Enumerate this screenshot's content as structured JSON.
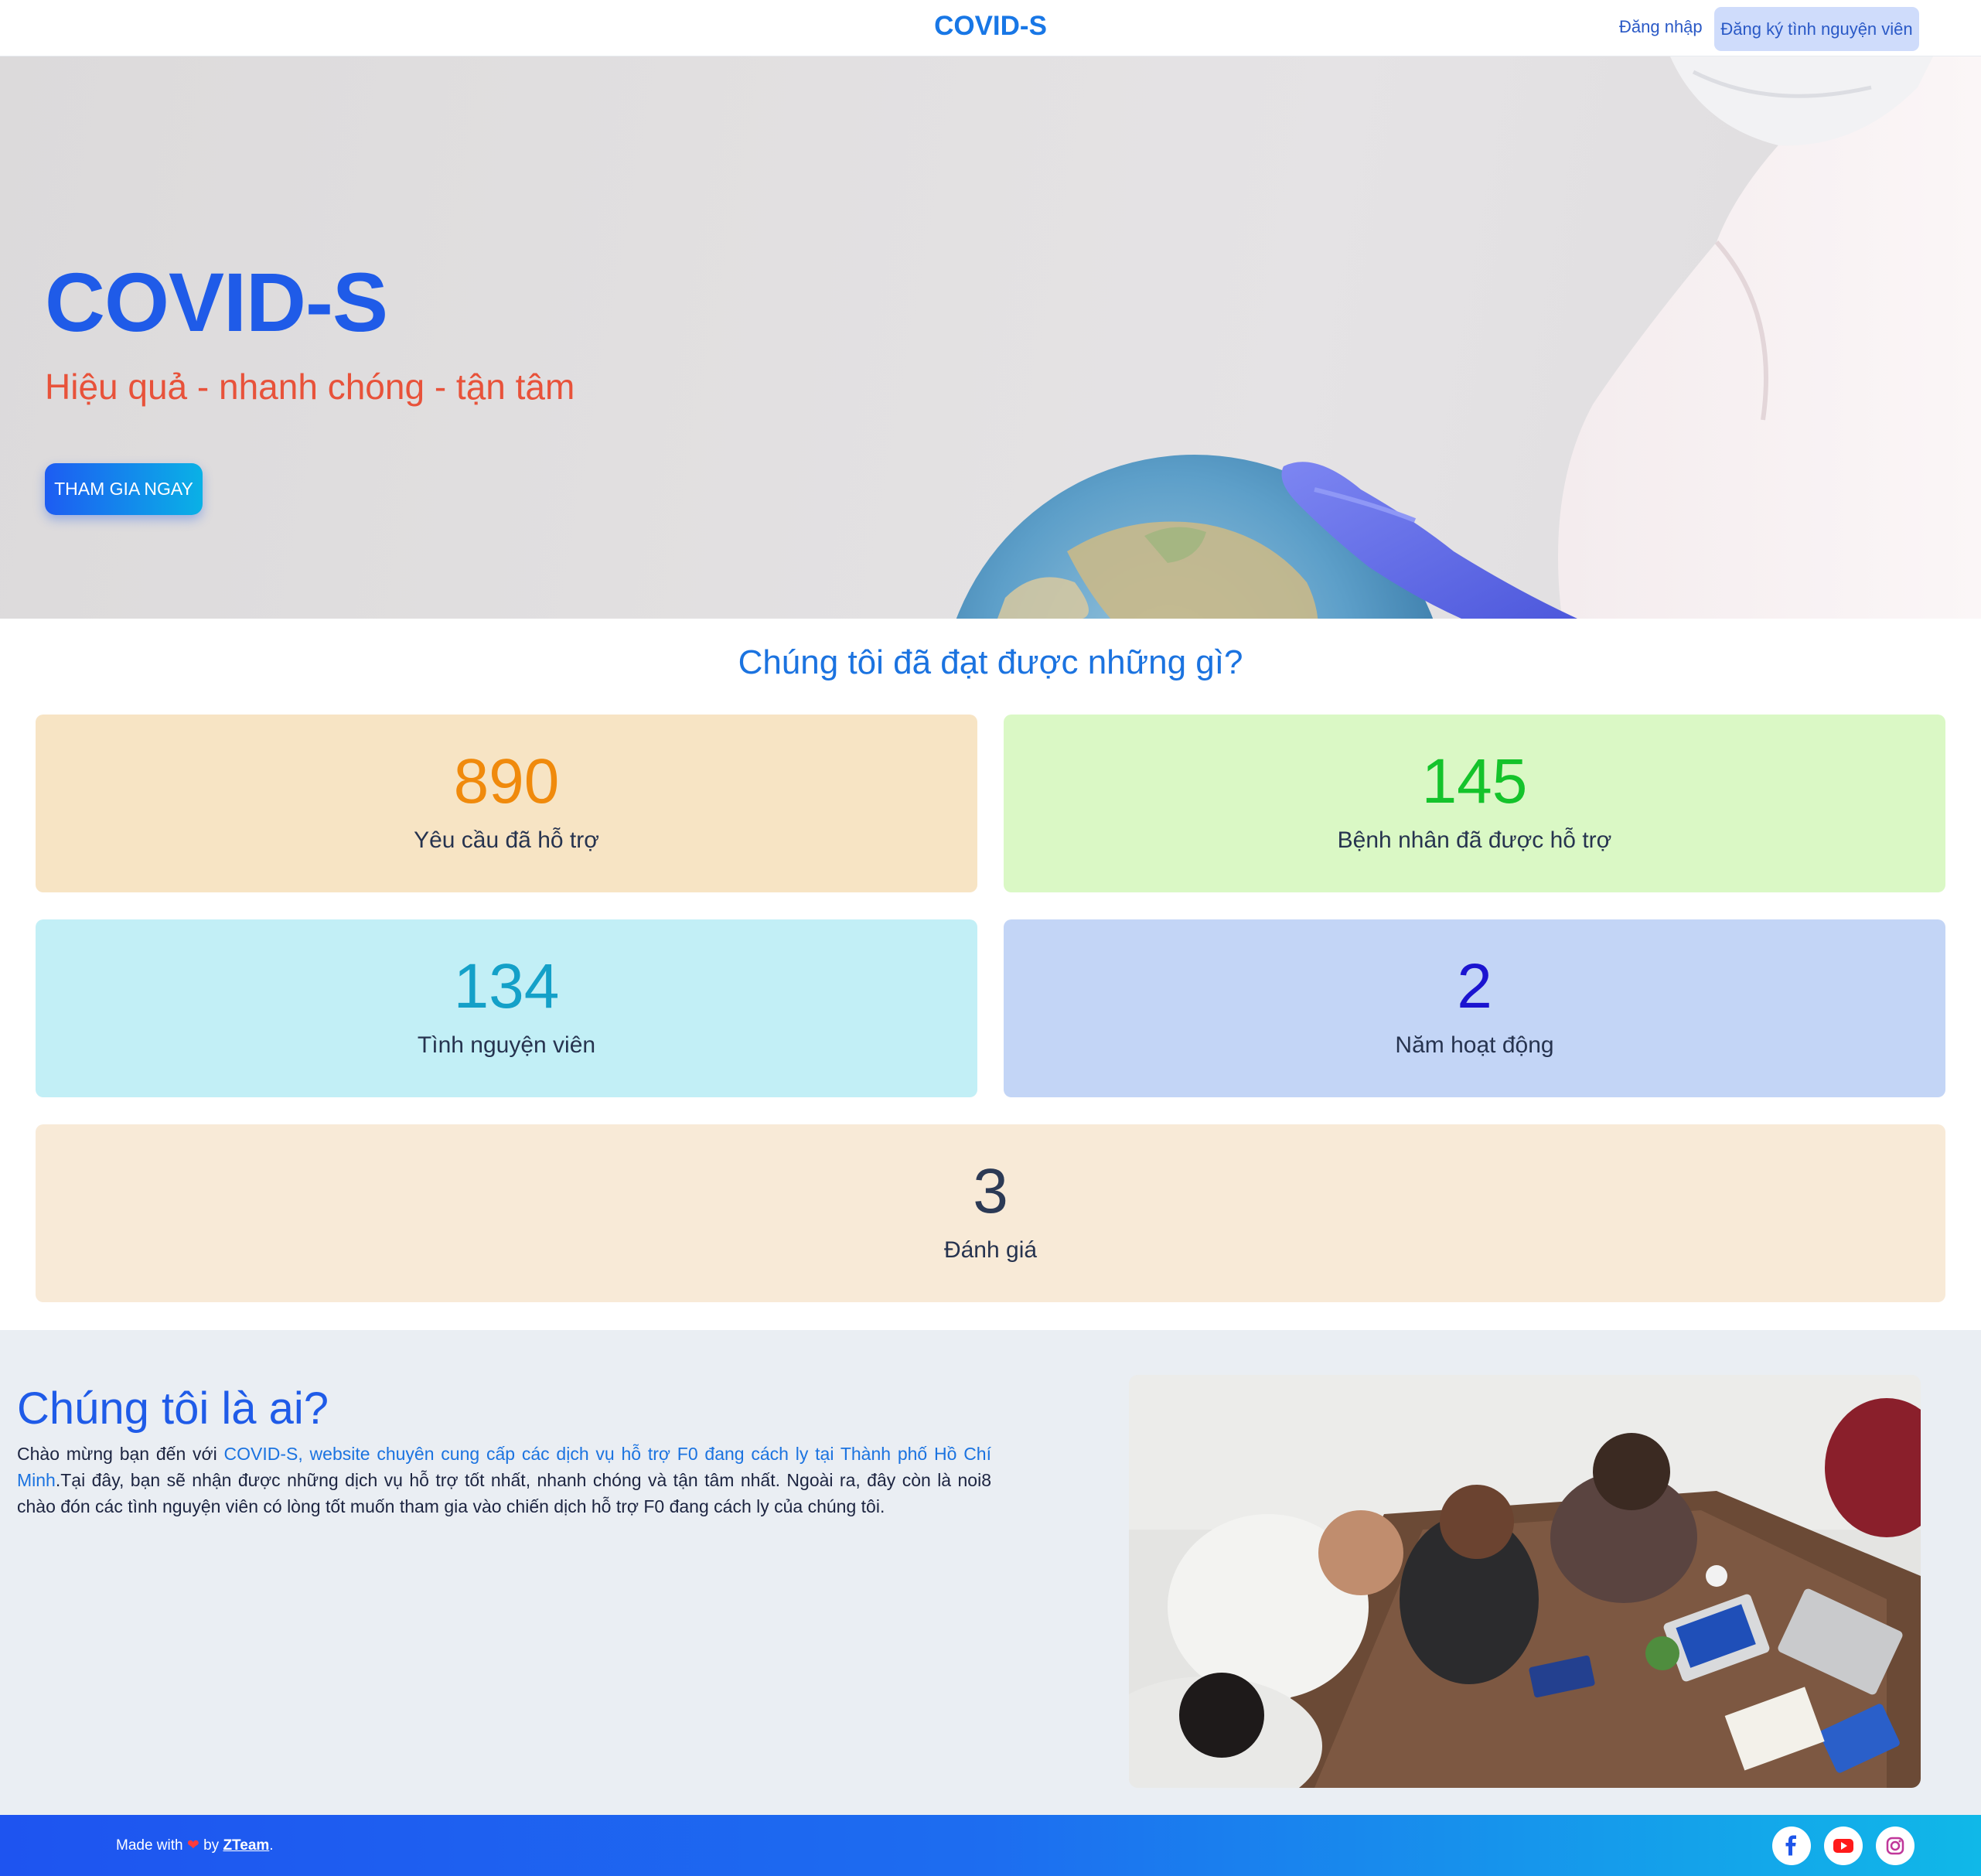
{
  "header": {
    "brand": "COVID-S",
    "login_label": "Đăng nhập",
    "register_label": "Đăng ký tình nguyện viên"
  },
  "hero": {
    "title": "COVID-S",
    "subtitle": "Hiệu quả - nhanh chóng - tận tâm",
    "cta_label": "THAM GIA NGAY"
  },
  "stats": {
    "title": "Chúng tôi đã đạt được những gì?",
    "items": [
      {
        "value": "890",
        "label": "Yêu cầu đã hỗ trợ",
        "color": "#f08a0c"
      },
      {
        "value": "145",
        "label": "Bệnh nhân đã được hỗ trợ",
        "color": "#14c32b"
      },
      {
        "value": "134",
        "label": "Tình nguyện viên",
        "color": "#14a0c8"
      },
      {
        "value": "2",
        "label": "Năm hoạt động",
        "color": "#1b14d0"
      },
      {
        "value": "3",
        "label": "Đánh giá",
        "color": "#2c3a55"
      }
    ]
  },
  "about": {
    "title": "Chúng tôi là ai?",
    "text_intro": "Chào mừng bạn đến với ",
    "text_highlight": "COVID-S, website chuyên cung cấp các dịch vụ hỗ trợ F0 đang cách ly tại Thành phố Hồ Chí Minh",
    "text_rest": ".Tại đây, bạn sẽ nhận được những dịch vụ hỗ trợ tốt nhất, nhanh chóng và tận tâm nhất. Ngoài ra, đây còn là noi8 chào đón các tình nguyện viên có lòng tốt muốn tham gia vào chiến dịch hỗ trợ F0 đang cách ly của chúng tôi."
  },
  "footer": {
    "made_with": "Made with",
    "by": "by",
    "team": "ZTeam",
    "period": ".",
    "social": [
      "facebook-icon",
      "youtube-icon",
      "instagram-icon"
    ]
  },
  "colors": {
    "brand_blue": "#1877e6",
    "accent_blue": "#1f5be8",
    "subtitle_orange": "#e8523a"
  }
}
